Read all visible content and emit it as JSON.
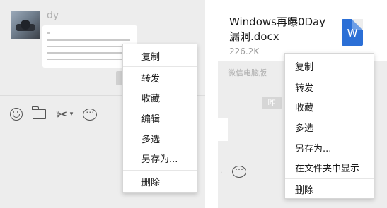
{
  "left": {
    "username": "dy",
    "toolbar": {
      "emoji_icon": "smile-icon",
      "file_icon": "folder-icon",
      "screenshot_icon": "scissors-icon",
      "screenshot_caret": "▾",
      "chat_icon": "chat-bubble-icon"
    },
    "menu": [
      "复制",
      "转发",
      "收藏",
      "编辑",
      "多选",
      "另存为...",
      "删除"
    ]
  },
  "right": {
    "file": {
      "name": "Windows再曝0Day漏洞.docx",
      "size": "226.2K",
      "icon_letter": "W",
      "source": "微信电脑版"
    },
    "time_tag": "昨",
    "stray_mark": "·",
    "menu": [
      "复制",
      "转发",
      "收藏",
      "多选",
      "另存为...",
      "在文件夹中显示",
      "删除"
    ]
  }
}
